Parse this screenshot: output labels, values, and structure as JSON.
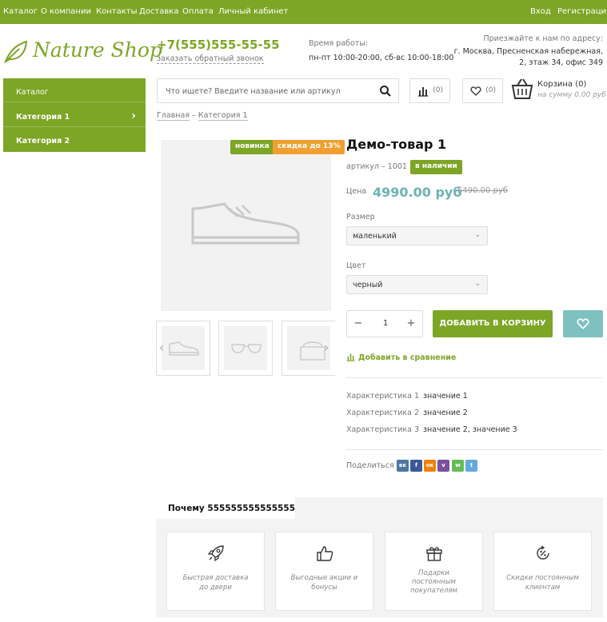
{
  "topnav": {
    "left": [
      "Каталог",
      "О компании",
      "Контакты",
      "Доставка",
      "Оплата",
      "Личный кабинет"
    ],
    "login": "Вход",
    "register": "Регистрация"
  },
  "header": {
    "logo": "Nature Shop",
    "phone": "+7(555)555-55-55",
    "callback": "заказать обратный звонок",
    "hours_label": "Время работы:",
    "hours": "пн-пт 10:00-20:00, сб-вс 10:00-18:00",
    "address_label": "Приезжайте к нам по адресу:",
    "address_line1": "г. Москва, Пресненская набережная,",
    "address_line2": "2, этаж 34, офис 349"
  },
  "sidebar": {
    "items": [
      {
        "label": "Каталог"
      },
      {
        "label": "Категория 1"
      },
      {
        "label": "Категория 2"
      }
    ]
  },
  "search": {
    "placeholder": "Что ищете? Введите название или артикул"
  },
  "tools": {
    "compare_count": "(0)",
    "fav_count": "(0)",
    "cart_title": "Корзина (0)",
    "cart_sum": "на сумму 0.00 руб"
  },
  "breadcrumb": {
    "home": "Главная",
    "sep": " – ",
    "current": "Категория 1"
  },
  "product": {
    "badge_new": "новинка",
    "badge_sale": "скидка до 13%",
    "title": "Демо-товар 1",
    "sku": "артикул – 1001",
    "stock": "в наличии",
    "price_label": "Цена",
    "price": "4990.00 руб",
    "old_price": "5490.00 руб",
    "size_label": "Размер",
    "size_value": "маленький",
    "color_label": "Цвет",
    "color_value": "черный",
    "qty": "1",
    "minus": "−",
    "plus": "+",
    "add_to_cart": "ДОБАВИТЬ В КОРЗИНУ",
    "add_compare": "Добавить в сравнение",
    "chars": [
      {
        "k": "Характеристика 1",
        "v": "значение 1"
      },
      {
        "k": "Характеристика 2",
        "v": "значение 2"
      },
      {
        "k": "Характеристика 3",
        "v": "значение 2, значение 3"
      }
    ],
    "share_label": "Поделиться",
    "social": [
      {
        "name": "vk",
        "label": "вк",
        "color": "#4c75a3"
      },
      {
        "name": "facebook",
        "label": "f",
        "color": "#3b5998"
      },
      {
        "name": "odnoklassniki",
        "label": "ок",
        "color": "#ee8208"
      },
      {
        "name": "viber",
        "label": "v",
        "color": "#7b519d"
      },
      {
        "name": "whatsapp",
        "label": "w",
        "color": "#65bc54"
      },
      {
        "name": "telegram",
        "label": "t",
        "color": "#64a9dc"
      }
    ]
  },
  "why": {
    "title": "Почему 555555555555555",
    "cards": [
      {
        "icon": "rocket-icon",
        "text_1": "Быстрая доставка",
        "text_2": "до двери"
      },
      {
        "icon": "thumbs-up-icon",
        "text_1": "Выгодные акции и",
        "text_2": "бонусы"
      },
      {
        "icon": "gift-icon",
        "text_1": "Подарки",
        "text_2": "постоянным",
        "text_3": "покупателям"
      },
      {
        "icon": "percent-icon",
        "text_1": "Скидки постоянным",
        "text_2": "клиентам"
      }
    ]
  },
  "colors": {
    "brand": "#7da526",
    "accent": "#6cb4b4",
    "sale": "#f0a030"
  }
}
